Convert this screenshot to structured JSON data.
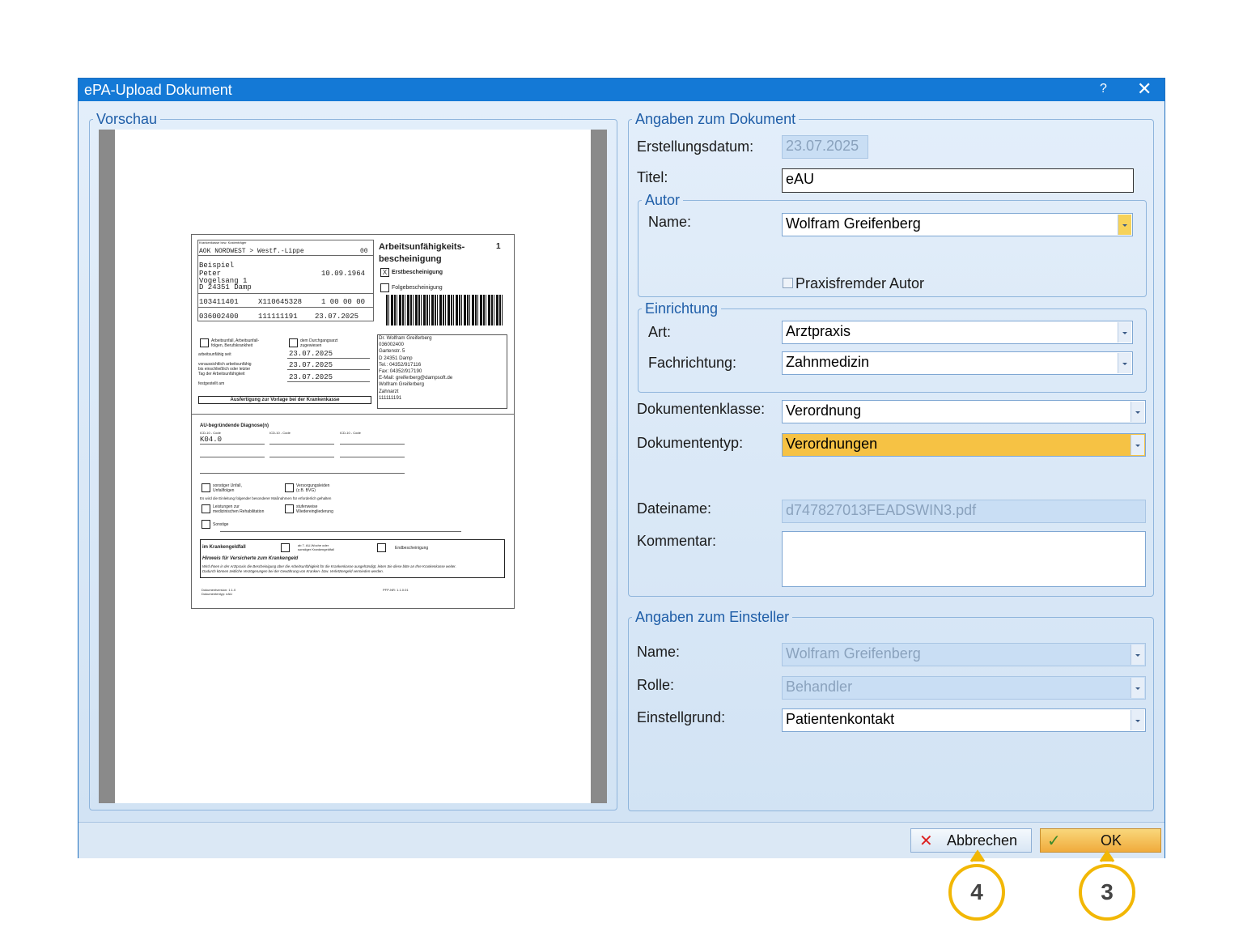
{
  "window": {
    "title": "ePA-Upload Dokument",
    "help": "?",
    "close": "✕"
  },
  "preview": {
    "legend": "Vorschau",
    "doc": {
      "kasse": "AOK NORDWEST > Westf.-Lippe",
      "kasse_nr": "00",
      "name1": "Beispiel",
      "name2": "Peter",
      "birth": "10.09.1964",
      "street": "Vogelsang 1",
      "city": "D 24351 Damp",
      "kassennr": "103411401",
      "versnr": "X110645328",
      "status": "1 00 00 00",
      "bsnr": "036002400",
      "lanr": "111111191",
      "datum": "23.07.2025",
      "title1": "Arbeitsunfähigkeits-",
      "title2": "bescheinigung",
      "copy_no": "1",
      "erst": "Erstbescheinigung",
      "folge": "Folgebescheinigung",
      "erst_mark": "X",
      "d1": "23.07.2025",
      "d2": "23.07.2025",
      "d3": "23.07.2025",
      "doctor": [
        "Dr. Wolfram Greiferberg",
        "036002400",
        "Gartenstr. 5",
        "D 24351 Damp",
        "Tel.: 04352/917116",
        "Fax: 04352/917190",
        "E-Mail: greiferberg@dampsoft.de",
        "Wolfram Greiferberg",
        "Zahnarzt",
        "111111191"
      ],
      "ausfertigung": "Ausfertigung zur Vorlage bei der Krankenkasse",
      "diag_head": "AU-begründende Diagnose(n)",
      "diag_code": "K04.0",
      "krankengeld": "im Krankengeldfall",
      "hinweis": "Hinweis für Versicherte zum Krankengeld"
    }
  },
  "document_info": {
    "legend": "Angaben zum Dokument",
    "created_label": "Erstellungsdatum:",
    "created_value": "23.07.2025",
    "title_label": "Titel:",
    "title_value": "eAU",
    "author_legend": "Autor",
    "author_name_label": "Name:",
    "author_name_value": "Wolfram Greifenberg",
    "external_author_label": "Praxisfremder Autor",
    "facility_legend": "Einrichtung",
    "art_label": "Art:",
    "art_value": "Arztpraxis",
    "fach_label": "Fachrichtung:",
    "fach_value": "Zahnmedizin",
    "class_label": "Dokumentenklasse:",
    "class_value": "Verordnung",
    "type_label": "Dokumententyp:",
    "type_value": "Verordnungen",
    "file_label": "Dateiname:",
    "file_value": "d747827013FEADSWIN3.pdf",
    "comment_label": "Kommentar:",
    "comment_value": ""
  },
  "uploader_info": {
    "legend": "Angaben zum Einsteller",
    "name_label": "Name:",
    "name_value": "Wolfram Greifenberg",
    "role_label": "Rolle:",
    "role_value": "Behandler",
    "reason_label": "Einstellgrund:",
    "reason_value": "Patientenkontakt"
  },
  "buttons": {
    "cancel_label": "Abbrechen",
    "ok_label": "OK"
  },
  "callouts": {
    "cancel_number": "4",
    "ok_number": "3"
  },
  "colors": {
    "titlebar": "#1479d6",
    "highlight": "#f6c244",
    "callout": "#f2b705"
  }
}
